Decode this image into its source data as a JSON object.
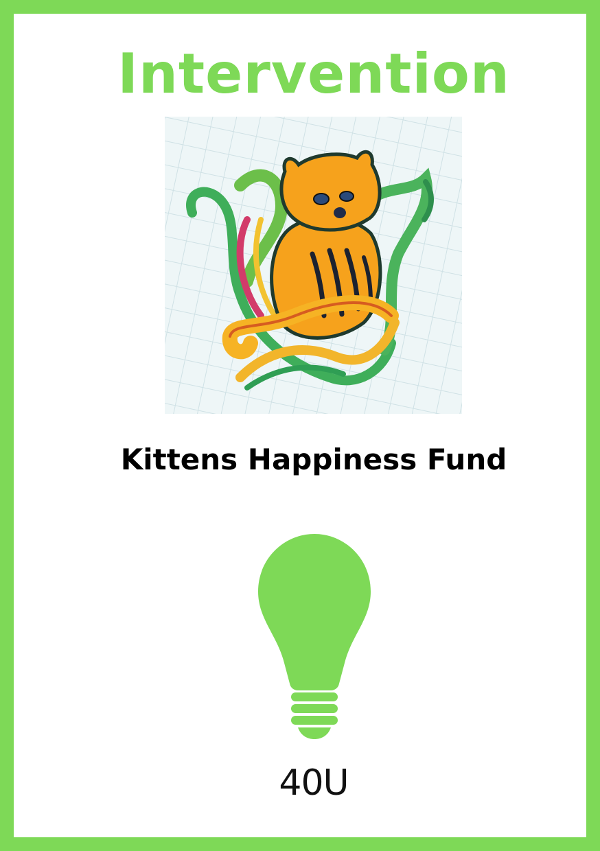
{
  "card": {
    "title": "Intervention",
    "name": "Kittens Happiness Fund",
    "cost": "40U"
  },
  "colors": {
    "accent": "#7ed957",
    "text": "#000000",
    "background": "#ffffff"
  },
  "icons": {
    "artwork": "kitten-illustration",
    "symbol": "lightbulb-icon"
  }
}
